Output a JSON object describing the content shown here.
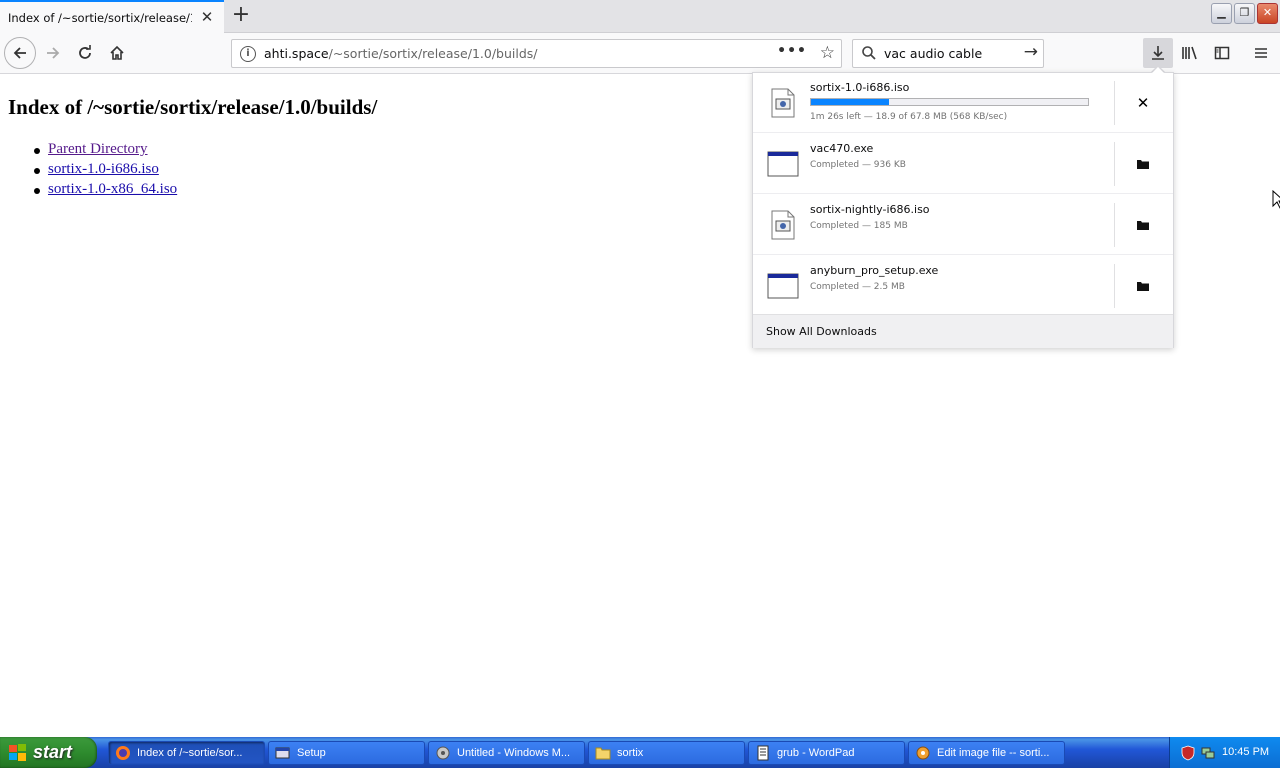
{
  "browser": {
    "tab": {
      "title": "Index of /~sortie/sortix/release/1.0/b",
      "close_icon": "close-icon"
    },
    "new_tab_icon": "plus-icon",
    "window_controls": [
      "minimize-icon",
      "restore-icon",
      "close-icon"
    ],
    "url": {
      "host": "ahti.space",
      "path": "/~sortie/sortix/release/1.0/builds/"
    },
    "page_actions": "•••",
    "search": {
      "value": "vac audio cable"
    }
  },
  "page": {
    "heading": "Index of /~sortie/sortix/release/1.0/builds/",
    "links": [
      {
        "label": "Parent Directory"
      },
      {
        "label": "sortix-1.0-i686.iso"
      },
      {
        "label": "sortix-1.0-x86_64.iso"
      }
    ]
  },
  "downloads": {
    "items": [
      {
        "name": "sortix-1.0-i686.iso",
        "status": "1m 26s left — 18.9 of 67.8 MB (568 KB/sec)",
        "progress": 0.28,
        "action": "cancel-icon"
      },
      {
        "name": "vac470.exe",
        "status": "Completed — 936 KB",
        "action": "folder-icon"
      },
      {
        "name": "sortix-nightly-i686.iso",
        "status": "Completed — 185 MB",
        "action": "folder-icon"
      },
      {
        "name": "anyburn_pro_setup.exe",
        "status": "Completed — 2.5 MB",
        "action": "folder-icon"
      }
    ],
    "show_all": "Show All Downloads"
  },
  "taskbar": {
    "start": "start",
    "tasks": [
      {
        "label": "Index of /~sortie/sor..."
      },
      {
        "label": "Setup"
      },
      {
        "label": "Untitled - Windows M..."
      },
      {
        "label": "sortix"
      },
      {
        "label": "grub - WordPad"
      },
      {
        "label": "Edit image file -- sorti..."
      }
    ],
    "clock": "10:45 PM"
  },
  "colors": {
    "accent": "#0a84ff",
    "taskbar": "#2157d7",
    "start": "#2e8b2e"
  }
}
